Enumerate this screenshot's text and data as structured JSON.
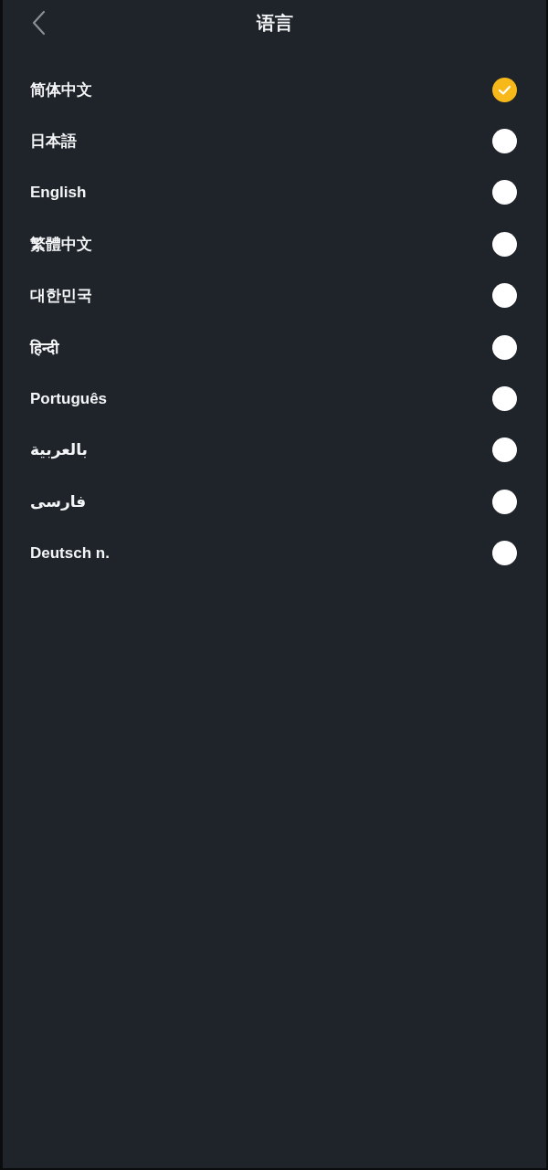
{
  "header": {
    "title": "语言"
  },
  "languages": [
    {
      "label": "简体中文",
      "selected": true
    },
    {
      "label": "日本語",
      "selected": false
    },
    {
      "label": "English",
      "selected": false
    },
    {
      "label": "繁體中文",
      "selected": false
    },
    {
      "label": "대한민국",
      "selected": false
    },
    {
      "label": "हिन्दी",
      "selected": false
    },
    {
      "label": "Português",
      "selected": false
    },
    {
      "label": "بالعربية",
      "selected": false
    },
    {
      "label": "فارسی",
      "selected": false
    },
    {
      "label": "Deutsch n.",
      "selected": false
    }
  ]
}
